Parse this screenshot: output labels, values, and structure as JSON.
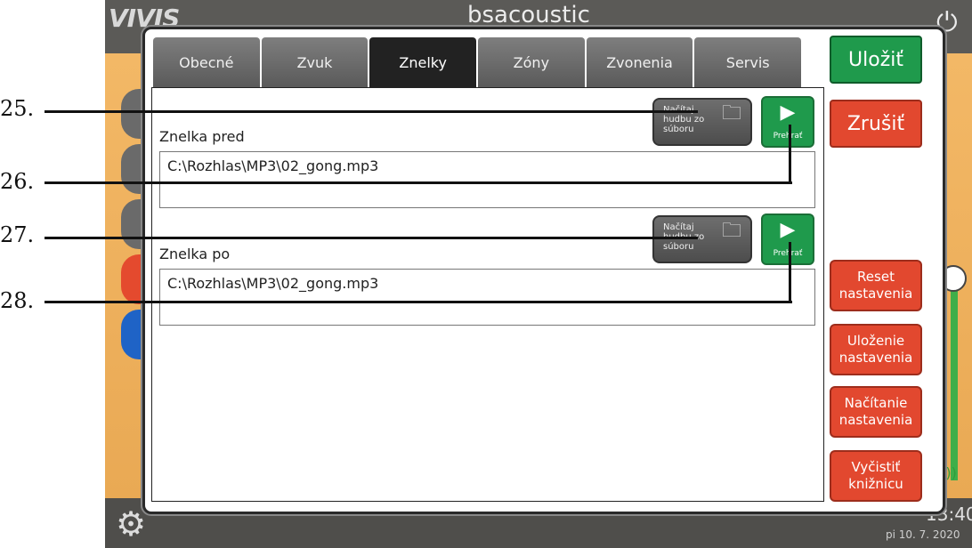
{
  "app": {
    "logo": "VIVIS",
    "brand": "bsacoustic",
    "clock": "13:40",
    "date": "pi 10. 7. 2020"
  },
  "tabs": [
    {
      "label": "Obecné",
      "active": false
    },
    {
      "label": "Zvuk",
      "active": false
    },
    {
      "label": "Znelky",
      "active": true
    },
    {
      "label": "Zóny",
      "active": false
    },
    {
      "label": "Zvonenia",
      "active": false
    },
    {
      "label": "Servis",
      "active": false
    }
  ],
  "chime_before": {
    "label": "Znelka pred",
    "path": "C:\\Rozhlas\\MP3\\02_gong.mp3",
    "load_button": "Načítaj hudbu zo súboru",
    "play_button": "Prehrať"
  },
  "chime_after": {
    "label": "Znelka po",
    "path": "C:\\Rozhlas\\MP3\\02_gong.mp3",
    "load_button": "Načítaj hudbu zo súboru",
    "play_button": "Prehrať"
  },
  "actions": {
    "save": "Uložiť",
    "cancel": "Zrušiť",
    "reset": "Reset nastavenia",
    "store": "Uloženie nastavenia",
    "load": "Načítanie nastavenia",
    "clear": "Vyčistiť knižnicu"
  },
  "callouts": [
    "25.",
    "26.",
    "27.",
    "28."
  ],
  "colors": {
    "save_green": "#1f9a4c",
    "danger_red": "#e2482f",
    "tab_active": "#222222"
  }
}
